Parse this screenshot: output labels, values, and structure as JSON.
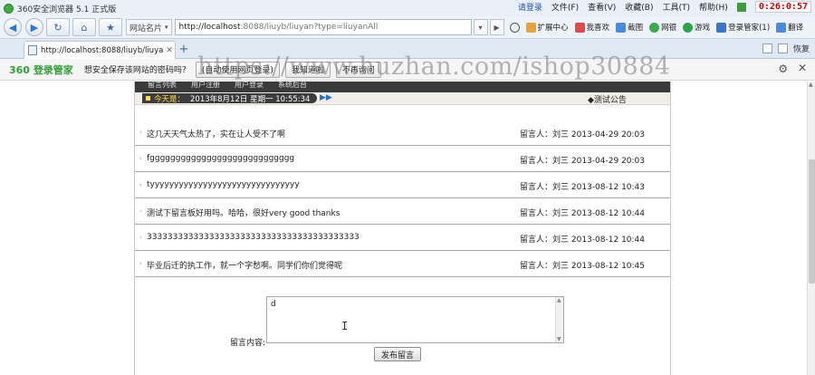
{
  "window": {
    "title": "360安全浏览器 5.1 正式版",
    "menu": [
      "请登录",
      "文件(F)",
      "查看(V)",
      "收藏(B)",
      "工具(T)",
      "帮助(H)"
    ],
    "clock": "0:26:0:57"
  },
  "navbar": {
    "site_card": "网站名片",
    "url_host": "http://localhost",
    "url_rest": ":8088/liuyb/liuyan?type=liuyanAll",
    "tools": [
      "扩展中心",
      "我喜欢",
      "截图",
      "网银",
      "游戏",
      "登录管家(1)",
      "翻译"
    ]
  },
  "tabbar": {
    "tab_title": "http://localhost:8088/liuyb/liuya...",
    "new_tab": "+",
    "restore": "恢复"
  },
  "infobar": {
    "logo_num": "360",
    "logo_text": "登录管家",
    "message": "想安全保存该网站的密码吗？",
    "btn_save": "(自动使用网页登录)",
    "btn_later": "我知道啦",
    "btn_never": "不再询问"
  },
  "watermark": "https://www.huzhan.com/ishop30884",
  "page": {
    "nav_items": [
      "留言列表",
      "用户注册",
      "用户登录",
      "系统后台"
    ],
    "today_label": "今天是：",
    "date_text": "2013年8月12日 星期一 10:55:34",
    "notice": "◆测试公告",
    "messages": [
      {
        "text": "这几天天气太热了，实在让人受不了啊",
        "author_label": "留言人：",
        "author": "刘三",
        "time": "2013-04-29 20:03"
      },
      {
        "text": "fgggggggggggggggggggggggggggg",
        "author_label": "留言人：",
        "author": "刘三",
        "time": "2013-04-29 20:03"
      },
      {
        "text": "tyyyyyyyyyyyyyyyyyyyyyyyyyyyyyyy",
        "author_label": "留言人：",
        "author": "刘三",
        "time": "2013-08-12 10:43"
      },
      {
        "text": "测试下留言板好用吗。哈哈，很好very good thanks",
        "author_label": "留言人：",
        "author": "刘三",
        "time": "2013-08-12 10:44"
      },
      {
        "text": "33333333333333333333333333333333333333333",
        "author_label": "留言人：",
        "author": "刘三",
        "time": "2013-08-12 10:44"
      },
      {
        "text": "毕业后迁的执工作，就一个字愁啊。同学们你们觉得呢",
        "author_label": "留言人：",
        "author": "刘三",
        "time": "2013-08-12 10:45"
      }
    ],
    "form": {
      "label": "留言内容:",
      "textarea_value": "d",
      "submit": "发布留言"
    }
  }
}
